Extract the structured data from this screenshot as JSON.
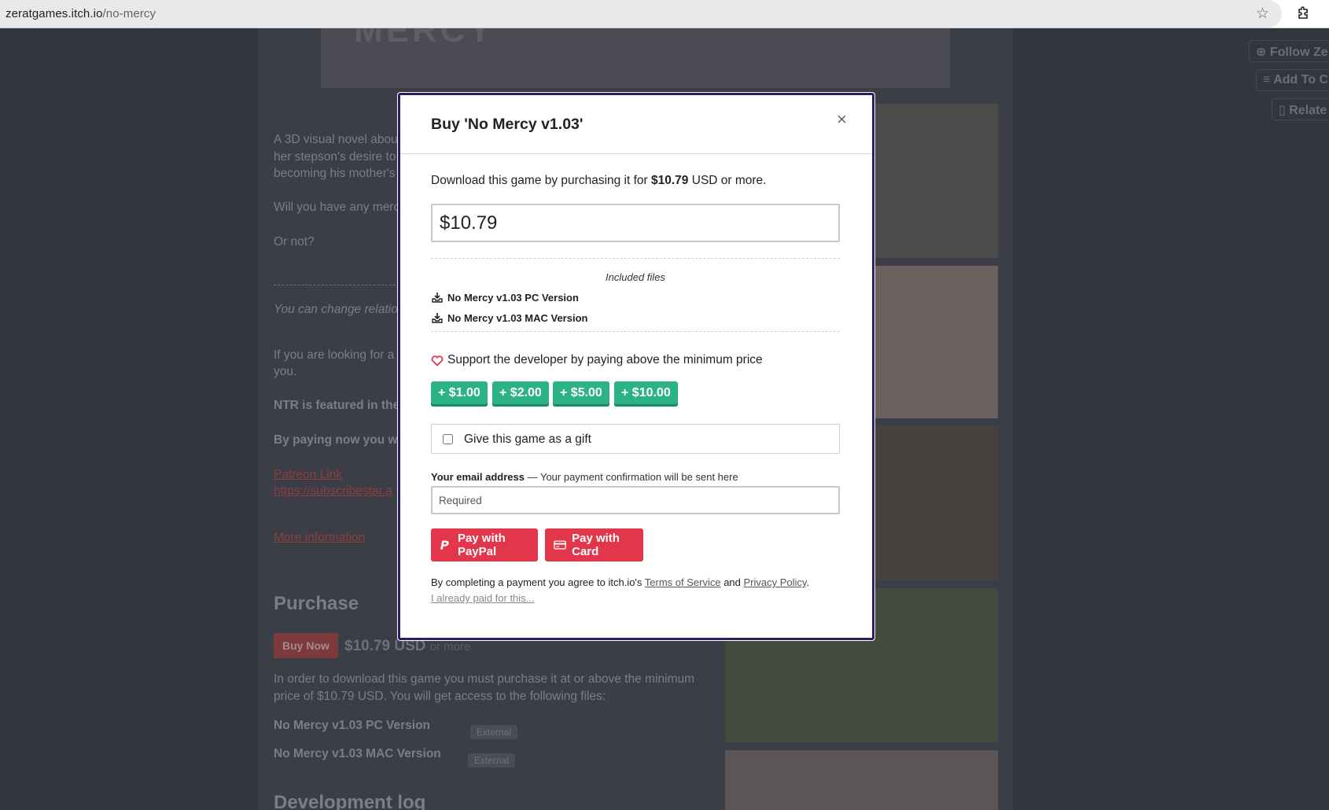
{
  "browser": {
    "url_domain": "zeratgames.itch.io",
    "url_path": "/no-mercy"
  },
  "background": {
    "banner_text": "MERCY",
    "desc_line1": "A 3D visual novel abou",
    "desc_line2": "her stepson's desire to",
    "desc_line3": "becoming his mother's",
    "mercy_q": "Will you have any merc",
    "or_not": "Or not?",
    "relations": "You can change relation",
    "looking_line1": "If you are looking for a",
    "looking_line2": "you.",
    "ntr": "NTR is featured in the",
    "paying": "By paying now you wi",
    "patreon": "Patreon Link",
    "subscribestar": "https://subscribestar.a",
    "more_info": "More information",
    "purchase_heading": "Purchase",
    "buy_now": "Buy Now",
    "price": "$10.79 USD",
    "price_suffix": "or more",
    "purchase_text_line1": "In order to download this game you must purchase it at or above the minimum",
    "purchase_text_line2": "price of $10.79 USD. You will get access to the following files:",
    "file1": "No Mercy v1.03 PC Version",
    "file2": "No Mercy v1.03 MAC Version",
    "external": "External",
    "devlog": "Development log",
    "follow": "Follow Ze",
    "add_to": "Add To C",
    "related": "Relate"
  },
  "modal": {
    "title": "Buy 'No Mercy v1.03'",
    "close": "×",
    "intro_pre": "Download this game by purchasing it for ",
    "intro_price": "$10.79",
    "intro_post": " USD or more.",
    "price_value": "$10.79",
    "included_files": "Included files",
    "files": [
      "No Mercy v1.03 PC Version",
      "No Mercy v1.03 MAC Version"
    ],
    "support_text": "Support the developer by paying above the minimum price",
    "tips": [
      "+ $1.00",
      "+ $2.00",
      "+ $5.00",
      "+ $10.00"
    ],
    "gift_label": "Give this game as a gift",
    "email_label": "Your email address",
    "email_note": " — Your payment confirmation will be sent here",
    "email_placeholder": "Required",
    "pay_paypal": "Pay with PayPal",
    "pay_card": "Pay with Card",
    "terms_pre": "By completing a payment you agree to itch.io's ",
    "terms_link": "Terms of Service",
    "terms_and": " and ",
    "privacy_link": "Privacy Policy",
    "terms_end": ".",
    "already_paid": "I already paid for this..."
  },
  "colors": {
    "accent_green": "#2bb384",
    "pay_red": "#e2364a",
    "modal_border": "#2d1b69",
    "heart": "#e2364a"
  },
  "icons": [
    "star-icon",
    "extension-icon",
    "download-icon",
    "heart-icon",
    "paypal-icon",
    "credit-card-icon",
    "close-icon",
    "follow-user-icon",
    "add-to-collection-icon",
    "related-map-icon"
  ]
}
